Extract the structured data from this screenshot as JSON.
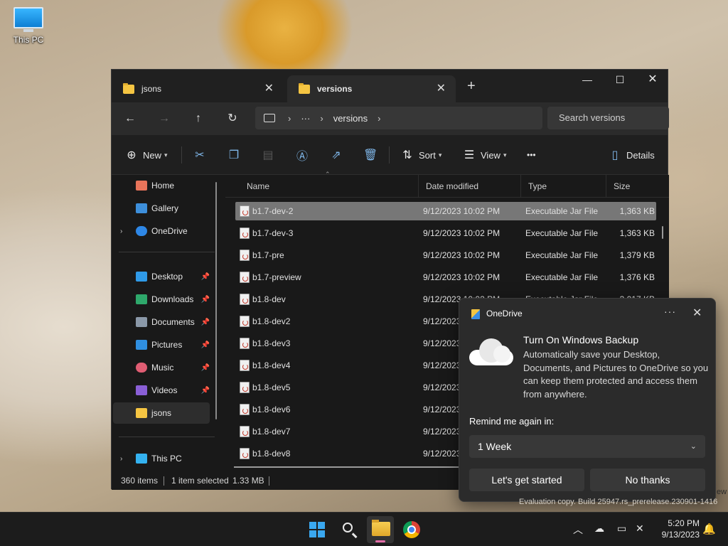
{
  "desktop": {
    "icon_label": "This PC"
  },
  "explorer": {
    "tabs": [
      {
        "title": "jsons"
      },
      {
        "title": "versions"
      }
    ],
    "window_controls": {
      "minimize": "—",
      "maximize": "☐",
      "close": "✕"
    },
    "address": {
      "ellipsis": "···",
      "current": "versions"
    },
    "search_placeholder": "Search versions",
    "commands": {
      "new": "New",
      "sort": "Sort",
      "view": "View",
      "more": "•••",
      "details": "Details"
    },
    "sidebar": {
      "home": "Home",
      "gallery": "Gallery",
      "onedrive": "OneDrive",
      "desktop": "Desktop",
      "downloads": "Downloads",
      "documents": "Documents",
      "pictures": "Pictures",
      "music": "Music",
      "videos": "Videos",
      "jsons": "jsons",
      "this_pc": "This PC"
    },
    "columns": {
      "name": "Name",
      "date": "Date modified",
      "type": "Type",
      "size": "Size"
    },
    "files": [
      {
        "name": "b1.7-dev-2",
        "date": "9/12/2023 10:02 PM",
        "type": "Executable Jar File",
        "size": "1,363 KB"
      },
      {
        "name": "b1.7-dev-3",
        "date": "9/12/2023 10:02 PM",
        "type": "Executable Jar File",
        "size": "1,363 KB"
      },
      {
        "name": "b1.7-pre",
        "date": "9/12/2023 10:02 PM",
        "type": "Executable Jar File",
        "size": "1,379 KB"
      },
      {
        "name": "b1.7-preview",
        "date": "9/12/2023 10:02 PM",
        "type": "Executable Jar File",
        "size": "1,376 KB"
      },
      {
        "name": "b1.8-dev",
        "date": "9/12/2023 10:02 PM",
        "type": "Executable Jar File",
        "size": "3,017 KB"
      },
      {
        "name": "b1.8-dev2",
        "date": "9/12/2023",
        "type": "",
        "size": ""
      },
      {
        "name": "b1.8-dev3",
        "date": "9/12/2023",
        "type": "",
        "size": ""
      },
      {
        "name": "b1.8-dev4",
        "date": "9/12/2023",
        "type": "",
        "size": ""
      },
      {
        "name": "b1.8-dev5",
        "date": "9/12/2023",
        "type": "",
        "size": ""
      },
      {
        "name": "b1.8-dev6",
        "date": "9/12/2023",
        "type": "",
        "size": ""
      },
      {
        "name": "b1.8-dev7",
        "date": "9/12/2023",
        "type": "",
        "size": ""
      },
      {
        "name": "b1.8-dev8",
        "date": "9/12/2023",
        "type": "",
        "size": ""
      }
    ],
    "status": {
      "count": "360 items",
      "selected": "1 item selected",
      "size": "1.33 MB"
    }
  },
  "toast": {
    "app": "OneDrive",
    "more": "···",
    "close": "✕",
    "headline": "Turn On Windows Backup",
    "body": "Automatically save your Desktop, Documents, and Pictures to OneDrive so you can keep them protected and access them from anywhere.",
    "remind_label": "Remind me again in:",
    "remind_value": "1 Week",
    "primary_button": "Let's get started",
    "secondary_button": "No thanks"
  },
  "watermark": {
    "text": "Evaluation copy. Build 25947.rs_prerelease.230901-1416",
    "edge": "ew"
  },
  "taskbar": {
    "time": "5:20 PM",
    "date": "9/13/2023"
  },
  "icons": {
    "tab_folder": "folder-icon",
    "back": "arrow-left-icon",
    "forward": "arrow-right-icon",
    "up": "arrow-up-icon",
    "refresh": "refresh-icon",
    "bell": "notification-bell-icon"
  }
}
